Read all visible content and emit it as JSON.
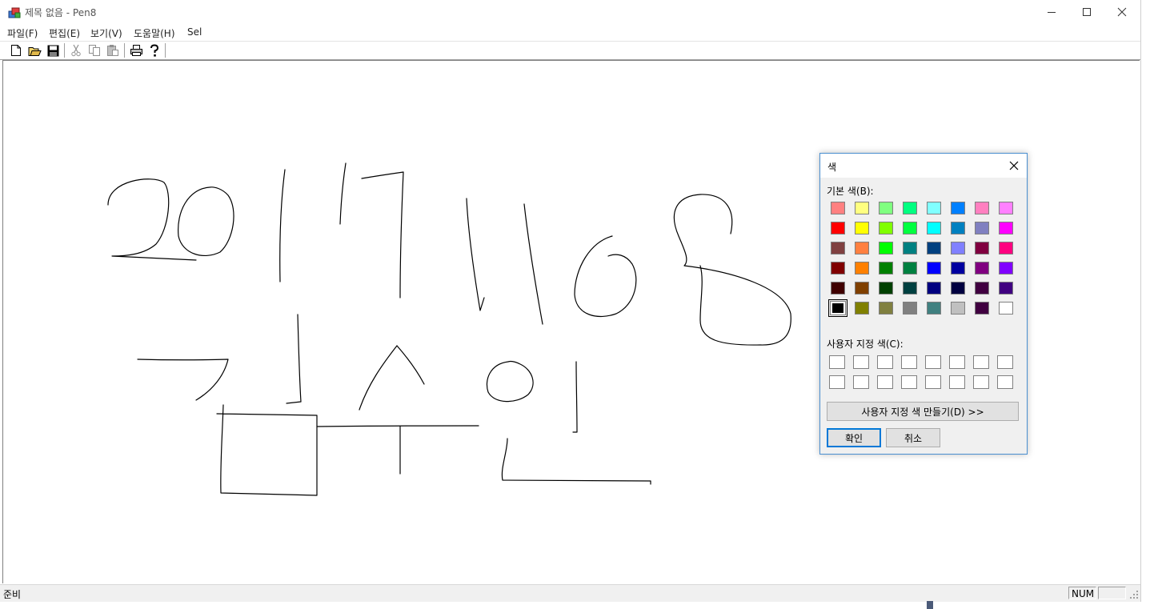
{
  "window": {
    "title": "제목 없음 - Pen8"
  },
  "menu": [
    "파일(F)",
    "편집(E)",
    "보기(V)",
    "도움말(H)",
    "Sel"
  ],
  "toolbar_icons": [
    "new-document-icon",
    "open-folder-icon",
    "save-icon",
    "cut-icon",
    "copy-icon",
    "paste-icon",
    "print-icon",
    "help-icon"
  ],
  "status": {
    "text": "준비",
    "num": "NUM"
  },
  "color_dialog": {
    "title": "색",
    "basic_label": "기본 색(B):",
    "custom_label": "사용자 지정 색(C):",
    "define_button": "사용자 지정 색 만들기(D) >>",
    "ok_button": "확인",
    "cancel_button": "취소",
    "selected_color": "#000000",
    "basic_colors": [
      [
        "#ff8080",
        "#ffff80",
        "#80ff80",
        "#00ff80",
        "#80ffff",
        "#0080ff",
        "#ff80c0",
        "#ff80ff"
      ],
      [
        "#ff0000",
        "#ffff00",
        "#80ff00",
        "#00ff40",
        "#00ffff",
        "#0080c0",
        "#8080c0",
        "#ff00ff"
      ],
      [
        "#804040",
        "#ff8040",
        "#00ff00",
        "#008080",
        "#004080",
        "#8080ff",
        "#800040",
        "#ff0080"
      ],
      [
        "#800000",
        "#ff8000",
        "#008000",
        "#008040",
        "#0000ff",
        "#0000a0",
        "#800080",
        "#8000ff"
      ],
      [
        "#400000",
        "#804000",
        "#004000",
        "#004040",
        "#000080",
        "#000040",
        "#400040",
        "#400080"
      ],
      [
        "#000000",
        "#808000",
        "#808040",
        "#808080",
        "#408080",
        "#c0c0c0",
        "#400040",
        "#ffffff"
      ]
    ]
  }
}
